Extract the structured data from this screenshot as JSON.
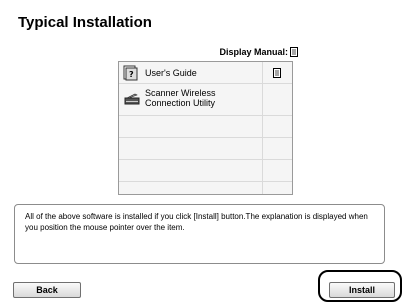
{
  "title": "Typical Installation",
  "display_manual_label": "Display Manual:",
  "software_list": [
    {
      "name": "User's Guide",
      "icon": "users-guide-book-icon",
      "has_manual": true
    },
    {
      "name": "Scanner Wireless Connection Utility",
      "icon": "scanner-icon",
      "has_manual": false
    }
  ],
  "empty_rows": 4,
  "description": "All of the above software is installed if you click [Install] button.The explanation is displayed when you position the mouse pointer over the item.",
  "buttons": {
    "back": "Back",
    "install": "Install"
  }
}
